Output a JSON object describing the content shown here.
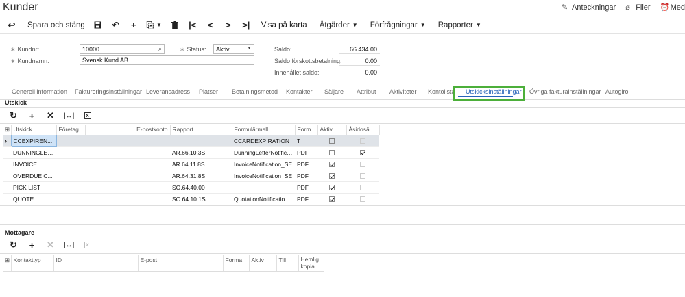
{
  "app": {
    "title": "Kunder"
  },
  "top_links": [
    {
      "icon": "edit-icon",
      "label": "Anteckningar"
    },
    {
      "icon": "paperclip-icon",
      "label": "Filer"
    },
    {
      "icon": "alarm-icon",
      "label": "Med"
    }
  ],
  "toolbar": {
    "save_close": "Spara och stäng",
    "show_map": "Visa på karta",
    "actions": "Åtgärder",
    "inquiries": "Förfrågningar",
    "reports": "Rapporter"
  },
  "form": {
    "customer_id_label": "Kundnr:",
    "customer_id_value": "10000",
    "customer_name_label": "Kundnamn:",
    "customer_name_value": "Svensk Kund AB",
    "status_label": "Status:",
    "status_value": "Aktiv",
    "balance_label": "Saldo:",
    "balance_value": "66 434.00",
    "prepay_label": "Saldo förskottsbetalning:",
    "prepay_value": "0.00",
    "retained_label": "Innehållet saldo:",
    "retained_value": "0.00"
  },
  "tabs": [
    "Generell information",
    "Faktureringsinställningar",
    "Leveransadress",
    "Platser",
    "Betalningsmetod",
    "Kontakter",
    "Säljare",
    "Attribut",
    "Aktiviteter",
    "Kontolista",
    "Utskicksinställningar",
    "Övriga fakturainställningar",
    "Autogiro"
  ],
  "mailings": {
    "title": "Utskick",
    "columns": [
      "Utskick",
      "Företag",
      "E-postkonto",
      "Rapport",
      "Formulärmall",
      "Form",
      "Aktiv",
      "Åsidosä"
    ],
    "rows": [
      {
        "mailing": "CCEXPIREN...",
        "company": "",
        "email_account": "",
        "report": "",
        "template": "CCARDEXPIRATION",
        "format": "T",
        "active": false,
        "override": false
      },
      {
        "mailing": "DUNNINGLET...",
        "company": "",
        "email_account": "",
        "report": "AR.66.10.3S",
        "template": "DunningLetterNotificat...",
        "format": "PDF",
        "active": false,
        "override": true
      },
      {
        "mailing": "INVOICE",
        "company": "",
        "email_account": "",
        "report": "AR.64.11.8S",
        "template": "InvoiceNotification_SE",
        "format": "PDF",
        "active": true,
        "override": false
      },
      {
        "mailing": "OVERDUE C...",
        "company": "",
        "email_account": "",
        "report": "AR.64.31.8S",
        "template": "InvoiceNotification_SE",
        "format": "PDF",
        "active": true,
        "override": false
      },
      {
        "mailing": "PICK LIST",
        "company": "",
        "email_account": "",
        "report": "SO.64.40.00",
        "template": "",
        "format": "PDF",
        "active": true,
        "override": false
      },
      {
        "mailing": "QUOTE",
        "company": "",
        "email_account": "",
        "report": "SO.64.10.1S",
        "template": "QuotationNotification_...",
        "format": "PDF",
        "active": true,
        "override": false
      }
    ]
  },
  "recipients": {
    "title": "Mottagare",
    "columns": [
      "Kontakttyp",
      "ID",
      "E-post",
      "Forma",
      "Aktiv",
      "Till",
      "Hemlig kopia"
    ]
  }
}
